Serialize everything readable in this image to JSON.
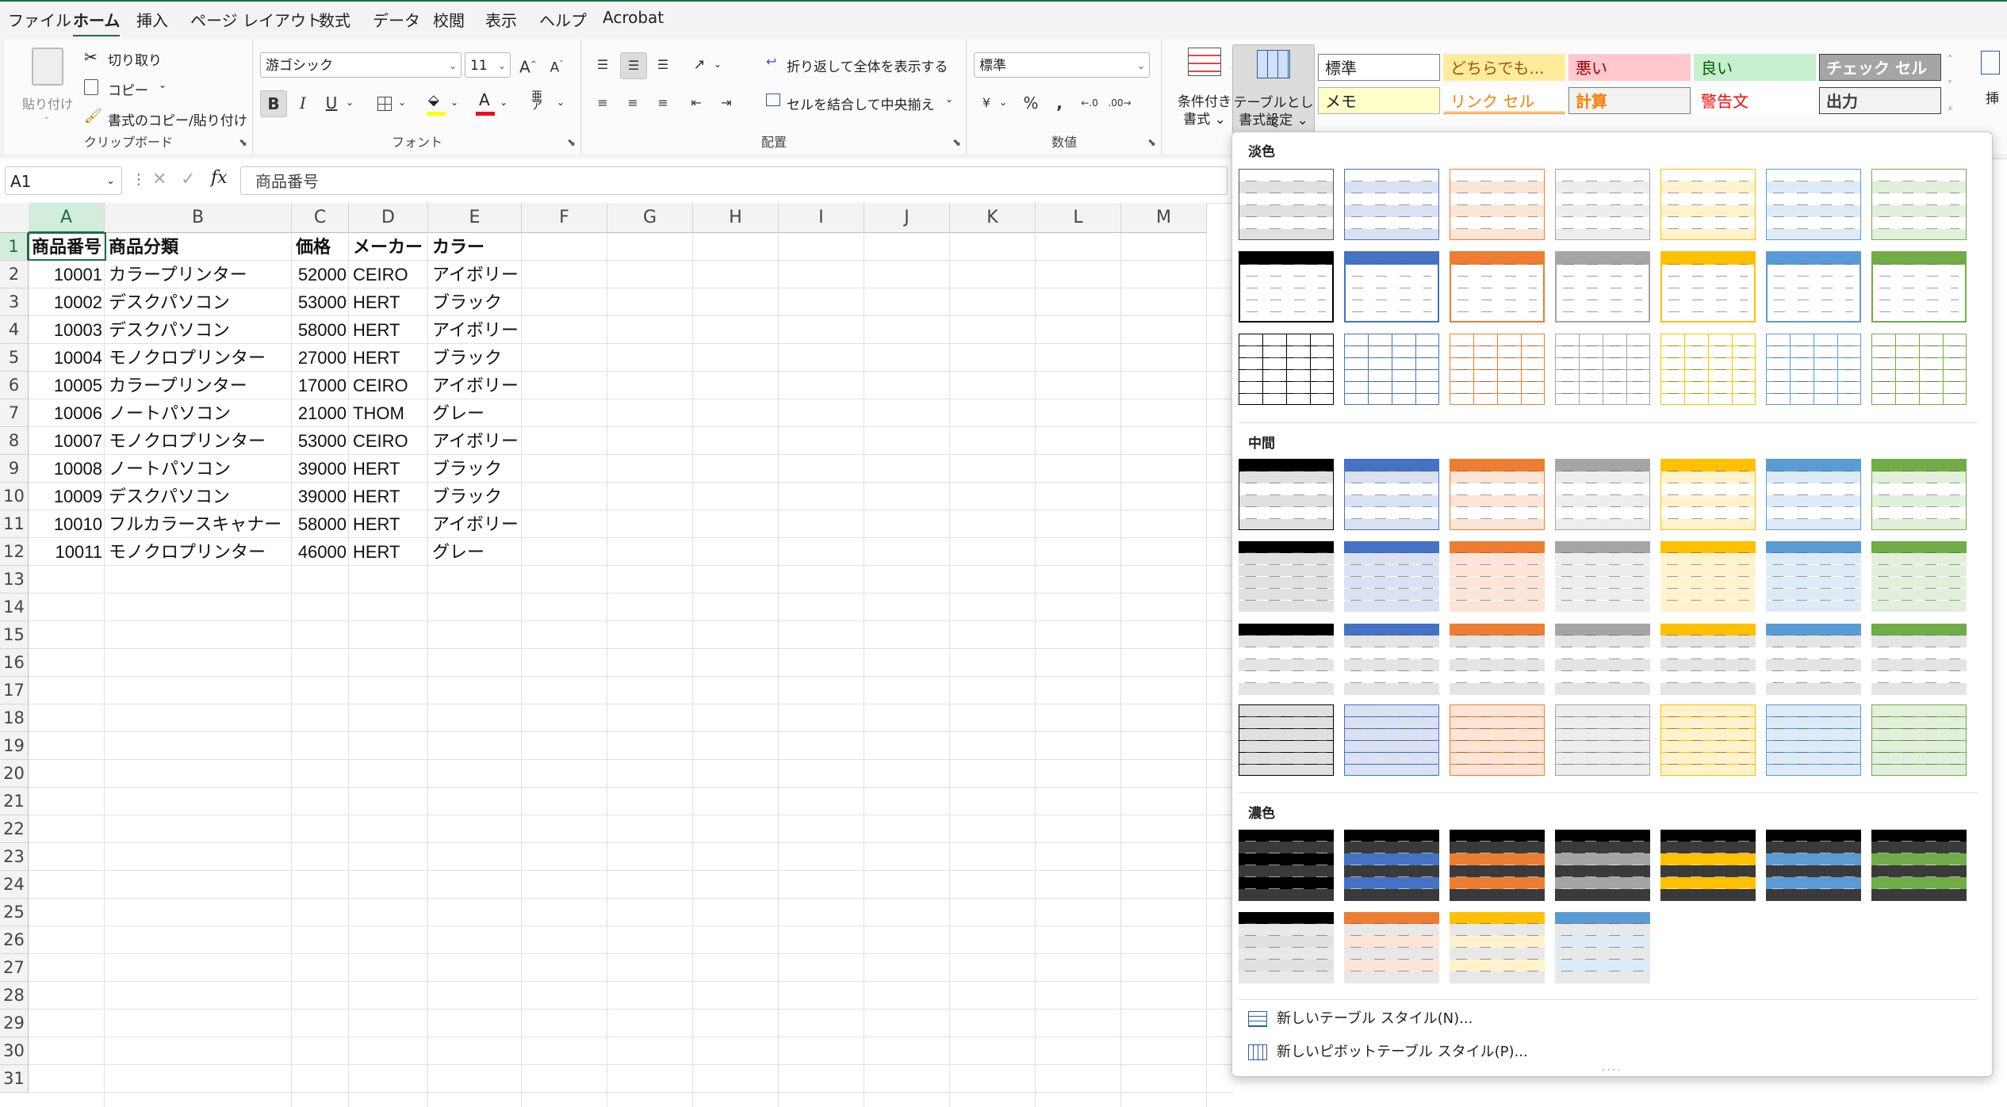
{
  "menu": {
    "items": [
      "ファイル",
      "ホーム",
      "挿入",
      "ページ レイアウト",
      "数式",
      "データ",
      "校閲",
      "表示",
      "ヘルプ",
      "Acrobat"
    ],
    "active": "ホーム"
  },
  "ribbon": {
    "clipboard": {
      "paste": "貼り付け",
      "cut": "切り取り",
      "copy": "コピー",
      "format_painter": "書式のコピー/貼り付け",
      "label": "クリップボード"
    },
    "font": {
      "name": "游ゴシック",
      "size": "11",
      "label": "フォント",
      "bold": "B",
      "italic": "I",
      "underline": "U",
      "font_color": "#e81123",
      "fill_color": "#ffff00"
    },
    "alignment": {
      "wrap_text": "折り返して全体を表示する",
      "merge_center": "セルを結合して中央揃え",
      "label": "配置"
    },
    "number": {
      "format": "標準",
      "label": "数値"
    },
    "styles": {
      "conditional": [
        "条件付き",
        "書式"
      ],
      "table_format": [
        "テーブルとして",
        "書式設定"
      ],
      "cells": [
        {
          "text": "標準",
          "bg": "#ffffff",
          "fg": "#222222",
          "border": "#7f7f7f"
        },
        {
          "text": "どちらでも...",
          "bg": "#ffeb9c",
          "fg": "#9c5700",
          "border": "#ffeb9c"
        },
        {
          "text": "悪い",
          "bg": "#ffc7ce",
          "fg": "#9c0006",
          "border": "#ffc7ce"
        },
        {
          "text": "良い",
          "bg": "#c6efce",
          "fg": "#006100",
          "border": "#c6efce"
        },
        {
          "text": "チェック セル",
          "bg": "#a5a5a5",
          "fg": "#ffffff",
          "border": "#3f3f3f"
        },
        {
          "text": "メモ",
          "bg": "#ffffcc",
          "fg": "#222222",
          "border": "#b2b2b2"
        },
        {
          "text": "リンク セル",
          "bg": "#ffffff",
          "fg": "#fa7d00",
          "border": "#ffffff"
        },
        {
          "text": "計算",
          "bg": "#f2f2f2",
          "fg": "#fa7d00",
          "border": "#7f7f7f"
        },
        {
          "text": "警告文",
          "bg": "#ffffff",
          "fg": "#ff0000",
          "border": "#ffffff"
        },
        {
          "text": "出力",
          "bg": "#f2f2f2",
          "fg": "#3f3f3f",
          "border": "#3f3f3f"
        }
      ],
      "insert_partial": "挿"
    }
  },
  "formula_bar": {
    "name_box": "A1",
    "content": "商品番号"
  },
  "sheet": {
    "columns": [
      "A",
      "B",
      "C",
      "D",
      "E",
      "F",
      "G",
      "H",
      "I",
      "J",
      "K",
      "L",
      "M"
    ],
    "row_count": 31,
    "header": [
      "商品番号",
      "商品分類",
      "価格",
      "メーカー",
      "カラー"
    ],
    "rows": [
      [
        "10001",
        "カラープリンター",
        "52000",
        "CEIRO",
        "アイボリー"
      ],
      [
        "10002",
        "デスクパソコン",
        "53000",
        "HERT",
        "ブラック"
      ],
      [
        "10003",
        "デスクパソコン",
        "58000",
        "HERT",
        "アイボリー"
      ],
      [
        "10004",
        "モノクロプリンター",
        "27000",
        "HERT",
        "ブラック"
      ],
      [
        "10005",
        "カラープリンター",
        "17000",
        "CEIRO",
        "アイボリー"
      ],
      [
        "10006",
        "ノートパソコン",
        "21000",
        "THOM",
        "グレー"
      ],
      [
        "10007",
        "モノクロプリンター",
        "53000",
        "CEIRO",
        "アイボリー"
      ],
      [
        "10008",
        "ノートパソコン",
        "39000",
        "HERT",
        "ブラック"
      ],
      [
        "10009",
        "デスクパソコン",
        "39000",
        "HERT",
        "ブラック"
      ],
      [
        "10010",
        "フルカラースキャナー",
        "58000",
        "HERT",
        "アイボリー"
      ],
      [
        "10011",
        "モノクロプリンター",
        "46000",
        "HERT",
        "グレー"
      ]
    ]
  },
  "gallery": {
    "sections": [
      {
        "title": "淡色",
        "count": 21
      },
      {
        "title": "中間",
        "count": 28
      },
      {
        "title": "濃色",
        "count": 11
      }
    ],
    "palette": [
      "#000000",
      "#4472c4",
      "#ed7d31",
      "#a5a5a5",
      "#ffc000",
      "#5b9bd5",
      "#70ad47"
    ],
    "light_palette": [
      "#e0e0e0",
      "#d9e1f2",
      "#fce4d6",
      "#ededed",
      "#fff2cc",
      "#ddebf7",
      "#e2efda"
    ],
    "new_table_style": "新しいテーブル スタイル(N)...",
    "new_pivot_style": "新しいピボットテーブル スタイル(P)..."
  }
}
